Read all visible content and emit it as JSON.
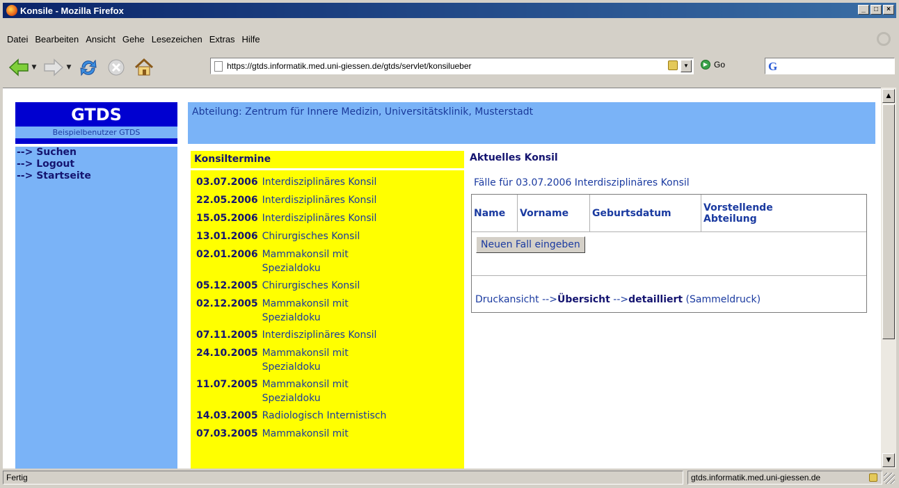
{
  "window": {
    "title": "Konsile - Mozilla Firefox",
    "btn_min": "_",
    "btn_max": "□",
    "btn_close": "×"
  },
  "menu": [
    "Datei",
    "Bearbeiten",
    "Ansicht",
    "Gehe",
    "Lesezeichen",
    "Extras",
    "Hilfe"
  ],
  "toolbar": {
    "url": "https://gtds.informatik.med.uni-giessen.de/gtds/servlet/konsilueber",
    "go_label": "Go",
    "search_logo": "G",
    "icons": [
      "back-arrow-icon",
      "forward-arrow-icon",
      "reload-icon",
      "stop-icon",
      "home-icon"
    ]
  },
  "header": {
    "logo": "GTDS",
    "user": "Beispielbenutzer GTDS",
    "department": "Abteilung: Zentrum für Innere Medizin, Universitätsklinik, Musterstadt"
  },
  "sidebar": {
    "items": [
      "--> Suchen",
      "--> Logout",
      "--> Startseite"
    ]
  },
  "konsiltermine": {
    "title": "Konsiltermine",
    "items": [
      {
        "date": "03.07.2006",
        "name": "Interdisziplinäres Konsil"
      },
      {
        "date": "22.05.2006",
        "name": "Interdisziplinäres Konsil"
      },
      {
        "date": "15.05.2006",
        "name": "Interdisziplinäres Konsil"
      },
      {
        "date": "13.01.2006",
        "name": "Chirurgisches Konsil"
      },
      {
        "date": "02.01.2006",
        "name": "Mammakonsil mit Spezialdoku"
      },
      {
        "date": "05.12.2005",
        "name": "Chirurgisches Konsil"
      },
      {
        "date": "02.12.2005",
        "name": "Mammakonsil mit Spezialdoku"
      },
      {
        "date": "07.11.2005",
        "name": "Interdisziplinäres Konsil"
      },
      {
        "date": "24.10.2005",
        "name": "Mammakonsil mit Spezialdoku"
      },
      {
        "date": "11.07.2005",
        "name": "Mammakonsil mit Spezialdoku"
      },
      {
        "date": "14.03.2005",
        "name": "Radiologisch Internistisch"
      },
      {
        "date": "07.03.2005",
        "name": "Mammakonsil mit"
      }
    ]
  },
  "aktuell": {
    "title": "Aktuelles Konsil",
    "subtitle": "Fälle für 03.07.2006 Interdisziplinäres Konsil",
    "columns": [
      "Name",
      "Vorname",
      "Geburtsdatum",
      "Vorstellende Abteilung"
    ],
    "new_case_button": "Neuen Fall eingeben",
    "print_prefix": "Druckansicht -->",
    "print_overview": "Übersicht",
    "print_arrow": " -->",
    "print_detailed": "detailliert",
    "print_collect": " (Sammeldruck)"
  },
  "status": {
    "left": "Fertig",
    "right": "gtds.informatik.med.uni-giessen.de"
  }
}
